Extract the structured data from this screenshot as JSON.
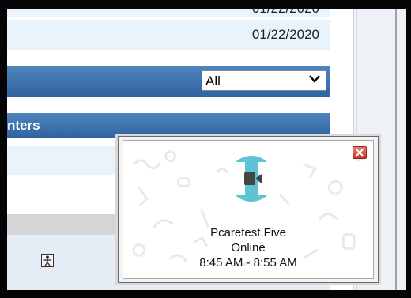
{
  "rows": {
    "partial_date": "01/22/2020",
    "date": "01/22/2020",
    "section_title": "nters"
  },
  "filter": {
    "selected": "All"
  },
  "popup": {
    "patient_name": "Pcaretest,Five",
    "status": "Online",
    "time_range": "8:45 AM - 8:55 AM"
  },
  "colors": {
    "header_blue": "#3a6fae",
    "video_teal": "#5ec3d4",
    "close_red": "#d9473b"
  },
  "icons": {
    "close": "close-icon",
    "video": "video-camera-icon",
    "person": "person-icon",
    "dropdown": "chevron-down-icon"
  }
}
